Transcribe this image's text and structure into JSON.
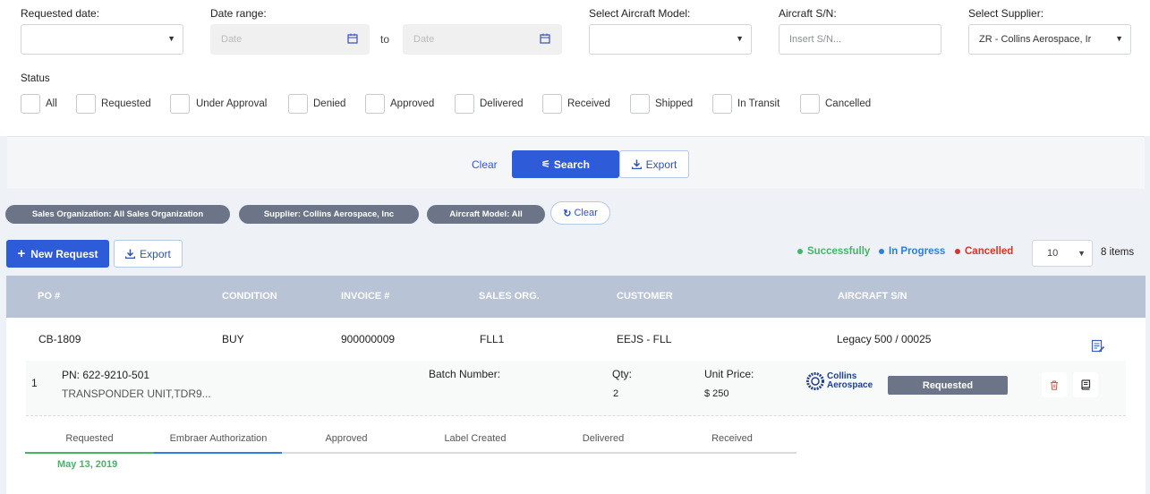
{
  "filters": {
    "requested_date": {
      "label": "Requested date:",
      "value": ""
    },
    "date_range": {
      "label": "Date range:",
      "from_placeholder": "Date",
      "to_text": "to",
      "to_placeholder": "Date"
    },
    "aircraft_model": {
      "label": "Select Aircraft Model:",
      "value": ""
    },
    "aircraft_sn": {
      "label": "Aircraft S/N:",
      "placeholder": "Insert S/N..."
    },
    "supplier": {
      "label": "Select Supplier:",
      "value": "ZR - Collins Aerospace, Ir"
    },
    "status": {
      "label": "Status",
      "options": [
        "All",
        "Requested",
        "Under Approval",
        "Denied",
        "Approved",
        "Delivered",
        "Received",
        "Shipped",
        "In Transit",
        "Cancelled"
      ]
    }
  },
  "actions": {
    "clear": "Clear",
    "search": "Search",
    "export": "Export"
  },
  "active_filters": {
    "chips": [
      "Sales Organization: All Sales Organization",
      "Supplier: Collins Aerospace, Inc",
      "Aircraft Model: All"
    ],
    "clear": "Clear"
  },
  "toolbar": {
    "new_request": "New Request",
    "export": "Export",
    "legend": [
      {
        "label": "Successfully",
        "color": "#43b56a"
      },
      {
        "label": "In Progress",
        "color": "#2f7de1"
      },
      {
        "label": "Cancelled",
        "color": "#d9342b"
      }
    ],
    "page_size": "10",
    "items_count": "8 items"
  },
  "table": {
    "columns": [
      "PO #",
      "CONDITION",
      "INVOICE #",
      "SALES ORG.",
      "CUSTOMER",
      "AIRCRAFT S/N"
    ],
    "rows": [
      {
        "po": "CB-1809",
        "condition": "BUY",
        "invoice": "900000009",
        "sales_org": "FLL1",
        "customer": "EEJS - FLL",
        "aircraft_sn": "Legacy 500 / 00025",
        "item": {
          "index": "1",
          "pn": "PN: 622-9210-501",
          "description": "TRANSPONDER UNIT,TDR9...",
          "batch_label": "Batch Number:",
          "qty_label": "Qty:",
          "qty": "2",
          "price_label": "Unit Price:",
          "price": "$ 250",
          "supplier_logo_line1": "Collins",
          "supplier_logo_line2": "Aerospace",
          "status": "Requested"
        },
        "steps": [
          "Requested",
          "Embraer Authorization",
          "Approved",
          "Label Created",
          "Delivered",
          "Received"
        ],
        "step_date": "May 13, 2019"
      }
    ]
  },
  "colors": {
    "primary": "#2e5bd7",
    "chip": "#6c7587",
    "header": "#b9c3d6",
    "success": "#43b56a",
    "progress": "#2f7de1",
    "danger": "#d9342b"
  }
}
